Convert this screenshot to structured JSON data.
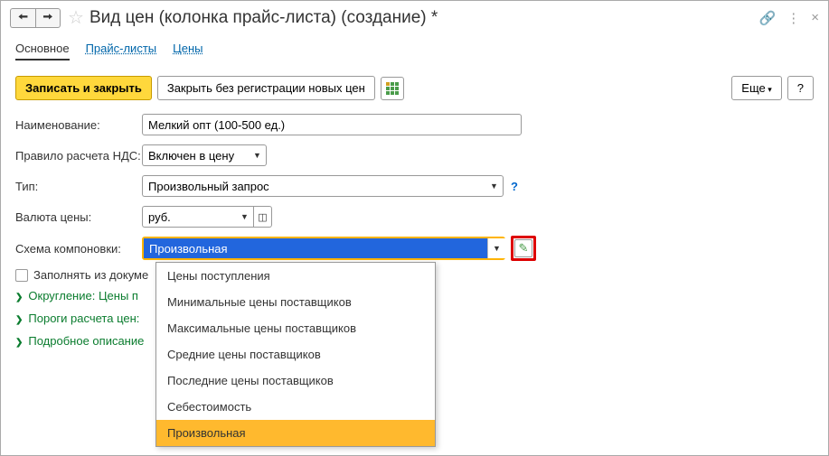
{
  "header": {
    "title": "Вид цен (колонка прайс-листа) (создание) *"
  },
  "tabs": {
    "main": "Основное",
    "pricelists": "Прайс-листы",
    "prices": "Цены"
  },
  "toolbar": {
    "save_close": "Записать и закрыть",
    "close_no_reg": "Закрыть без регистрации новых цен",
    "more": "Еще",
    "help": "?"
  },
  "form": {
    "name_label": "Наименование:",
    "name_value": "Мелкий опт (100-500 ед.)",
    "vat_label": "Правило расчета НДС:",
    "vat_value": "Включен в цену",
    "type_label": "Тип:",
    "type_value": "Произвольный запрос",
    "currency_label": "Валюта цены:",
    "currency_value": "руб.",
    "scheme_label": "Схема компоновки:",
    "scheme_value": "Произвольная",
    "fill_docs": "Заполнять из докуме",
    "exp1": "Округление: Цены п",
    "exp2": "Пороги расчета цен:",
    "exp3": "Подробное описание"
  },
  "dropdown": {
    "items": [
      "Цены поступления",
      "Минимальные цены поставщиков",
      "Максимальные цены поставщиков",
      "Средние цены поставщиков",
      "Последние цены поставщиков",
      "Себестоимость",
      "Произвольная"
    ],
    "selected_index": 6
  }
}
